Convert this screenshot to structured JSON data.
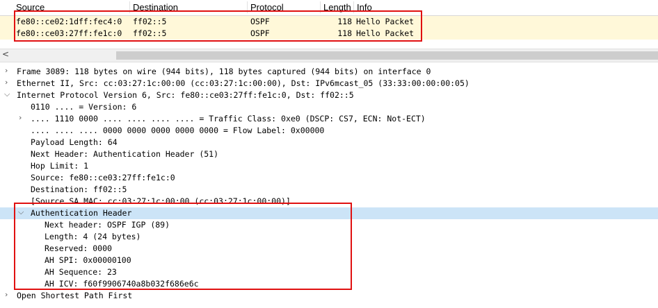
{
  "packet_list": {
    "columns": [
      "Source",
      "Destination",
      "Protocol",
      "Length",
      "Info"
    ],
    "rows": [
      {
        "source": "fe80::ce02:1dff:fec4:0",
        "destination": "ff02::5",
        "protocol": "OSPF",
        "length": "118",
        "info": "Hello Packet"
      },
      {
        "source": "fe80::ce03:27ff:fe1c:0",
        "destination": "ff02::5",
        "protocol": "OSPF",
        "length": "118",
        "info": "Hello Packet"
      }
    ]
  },
  "scrollbar": {
    "left_arrow": "<"
  },
  "details": {
    "frame": "Frame 3089: 118 bytes on wire (944 bits), 118 bytes captured (944 bits) on interface 0",
    "ethernet": "Ethernet II, Src: cc:03:27:1c:00:00 (cc:03:27:1c:00:00), Dst: IPv6mcast_05 (33:33:00:00:00:05)",
    "ipv6": "Internet Protocol Version 6, Src: fe80::ce03:27ff:fe1c:0, Dst: ff02::5",
    "ipv6_fields": {
      "version": "0110 .... = Version: 6",
      "traffic_class": ".... 1110 0000 .... .... .... .... = Traffic Class: 0xe0 (DSCP: CS7, ECN: Not-ECT)",
      "flow_label": ".... .... .... 0000 0000 0000 0000 0000 = Flow Label: 0x00000",
      "payload_length": "Payload Length: 64",
      "next_header": "Next Header: Authentication Header (51)",
      "hop_limit": "Hop Limit: 1",
      "source": "Source: fe80::ce03:27ff:fe1c:0",
      "destination": "Destination: ff02::5",
      "source_sa_mac": "[Source SA MAC: cc:03:27:1c:00:00 (cc:03:27:1c:00:00)]"
    },
    "auth_header": "Authentication Header",
    "ah_fields": {
      "next_header": "Next header: OSPF IGP (89)",
      "length": "Length: 4 (24 bytes)",
      "reserved": "Reserved: 0000",
      "spi": "AH SPI: 0x00000100",
      "sequence": "AH Sequence: 23",
      "icv": "AH ICV: f60f9906740a8b032f686e6c"
    },
    "ospf": "Open Shortest Path First"
  },
  "icons": {
    "collapsed": "chevron-right-icon",
    "expanded": "chevron-down-icon"
  },
  "colors": {
    "row_highlight": "#fff8d9",
    "selection": "#cce4f7",
    "annotation_box": "#e01010"
  }
}
